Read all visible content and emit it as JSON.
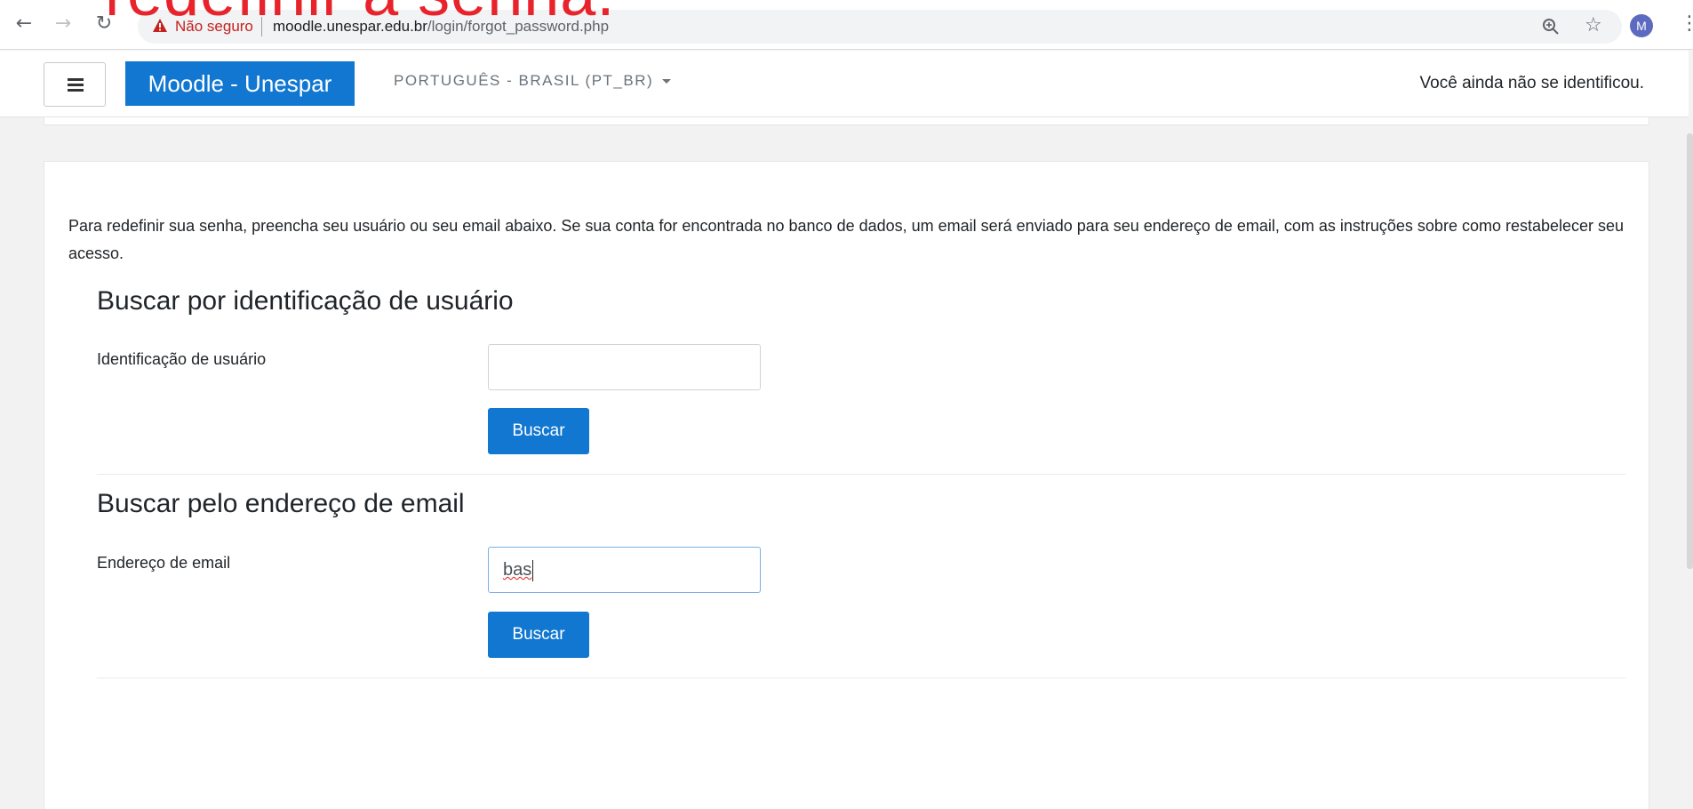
{
  "overlay": {
    "title_text": "redefinir a senha."
  },
  "browser": {
    "security_label": "Não seguro",
    "url_host": "moodle.unespar.edu.br",
    "url_path": "/login/forgot_password.php",
    "profile_initial": "M"
  },
  "navbar": {
    "brand": "Moodle - Unespar",
    "language": "PORTUGUÊS - BRASIL (PT_BR)",
    "login_status": "Você ainda não se identificou."
  },
  "main": {
    "intro": "Para redefinir sua senha, preencha seu usuário ou seu email abaixo. Se sua conta for encontrada no banco de dados, um email será enviado para seu endereço de email, com as instruções sobre como restabelecer seu acesso.",
    "username_section": {
      "title": "Buscar por identificação de usuário",
      "label": "Identificação de usuário",
      "value": "",
      "button": "Buscar"
    },
    "email_section": {
      "title": "Buscar pelo endereço de email",
      "label": "Endereço de email",
      "value": "bas",
      "button": "Buscar"
    }
  },
  "colors": {
    "brand_blue": "#1177d1",
    "overlay_red": "#e8232b",
    "warning_red": "#c5221f"
  }
}
